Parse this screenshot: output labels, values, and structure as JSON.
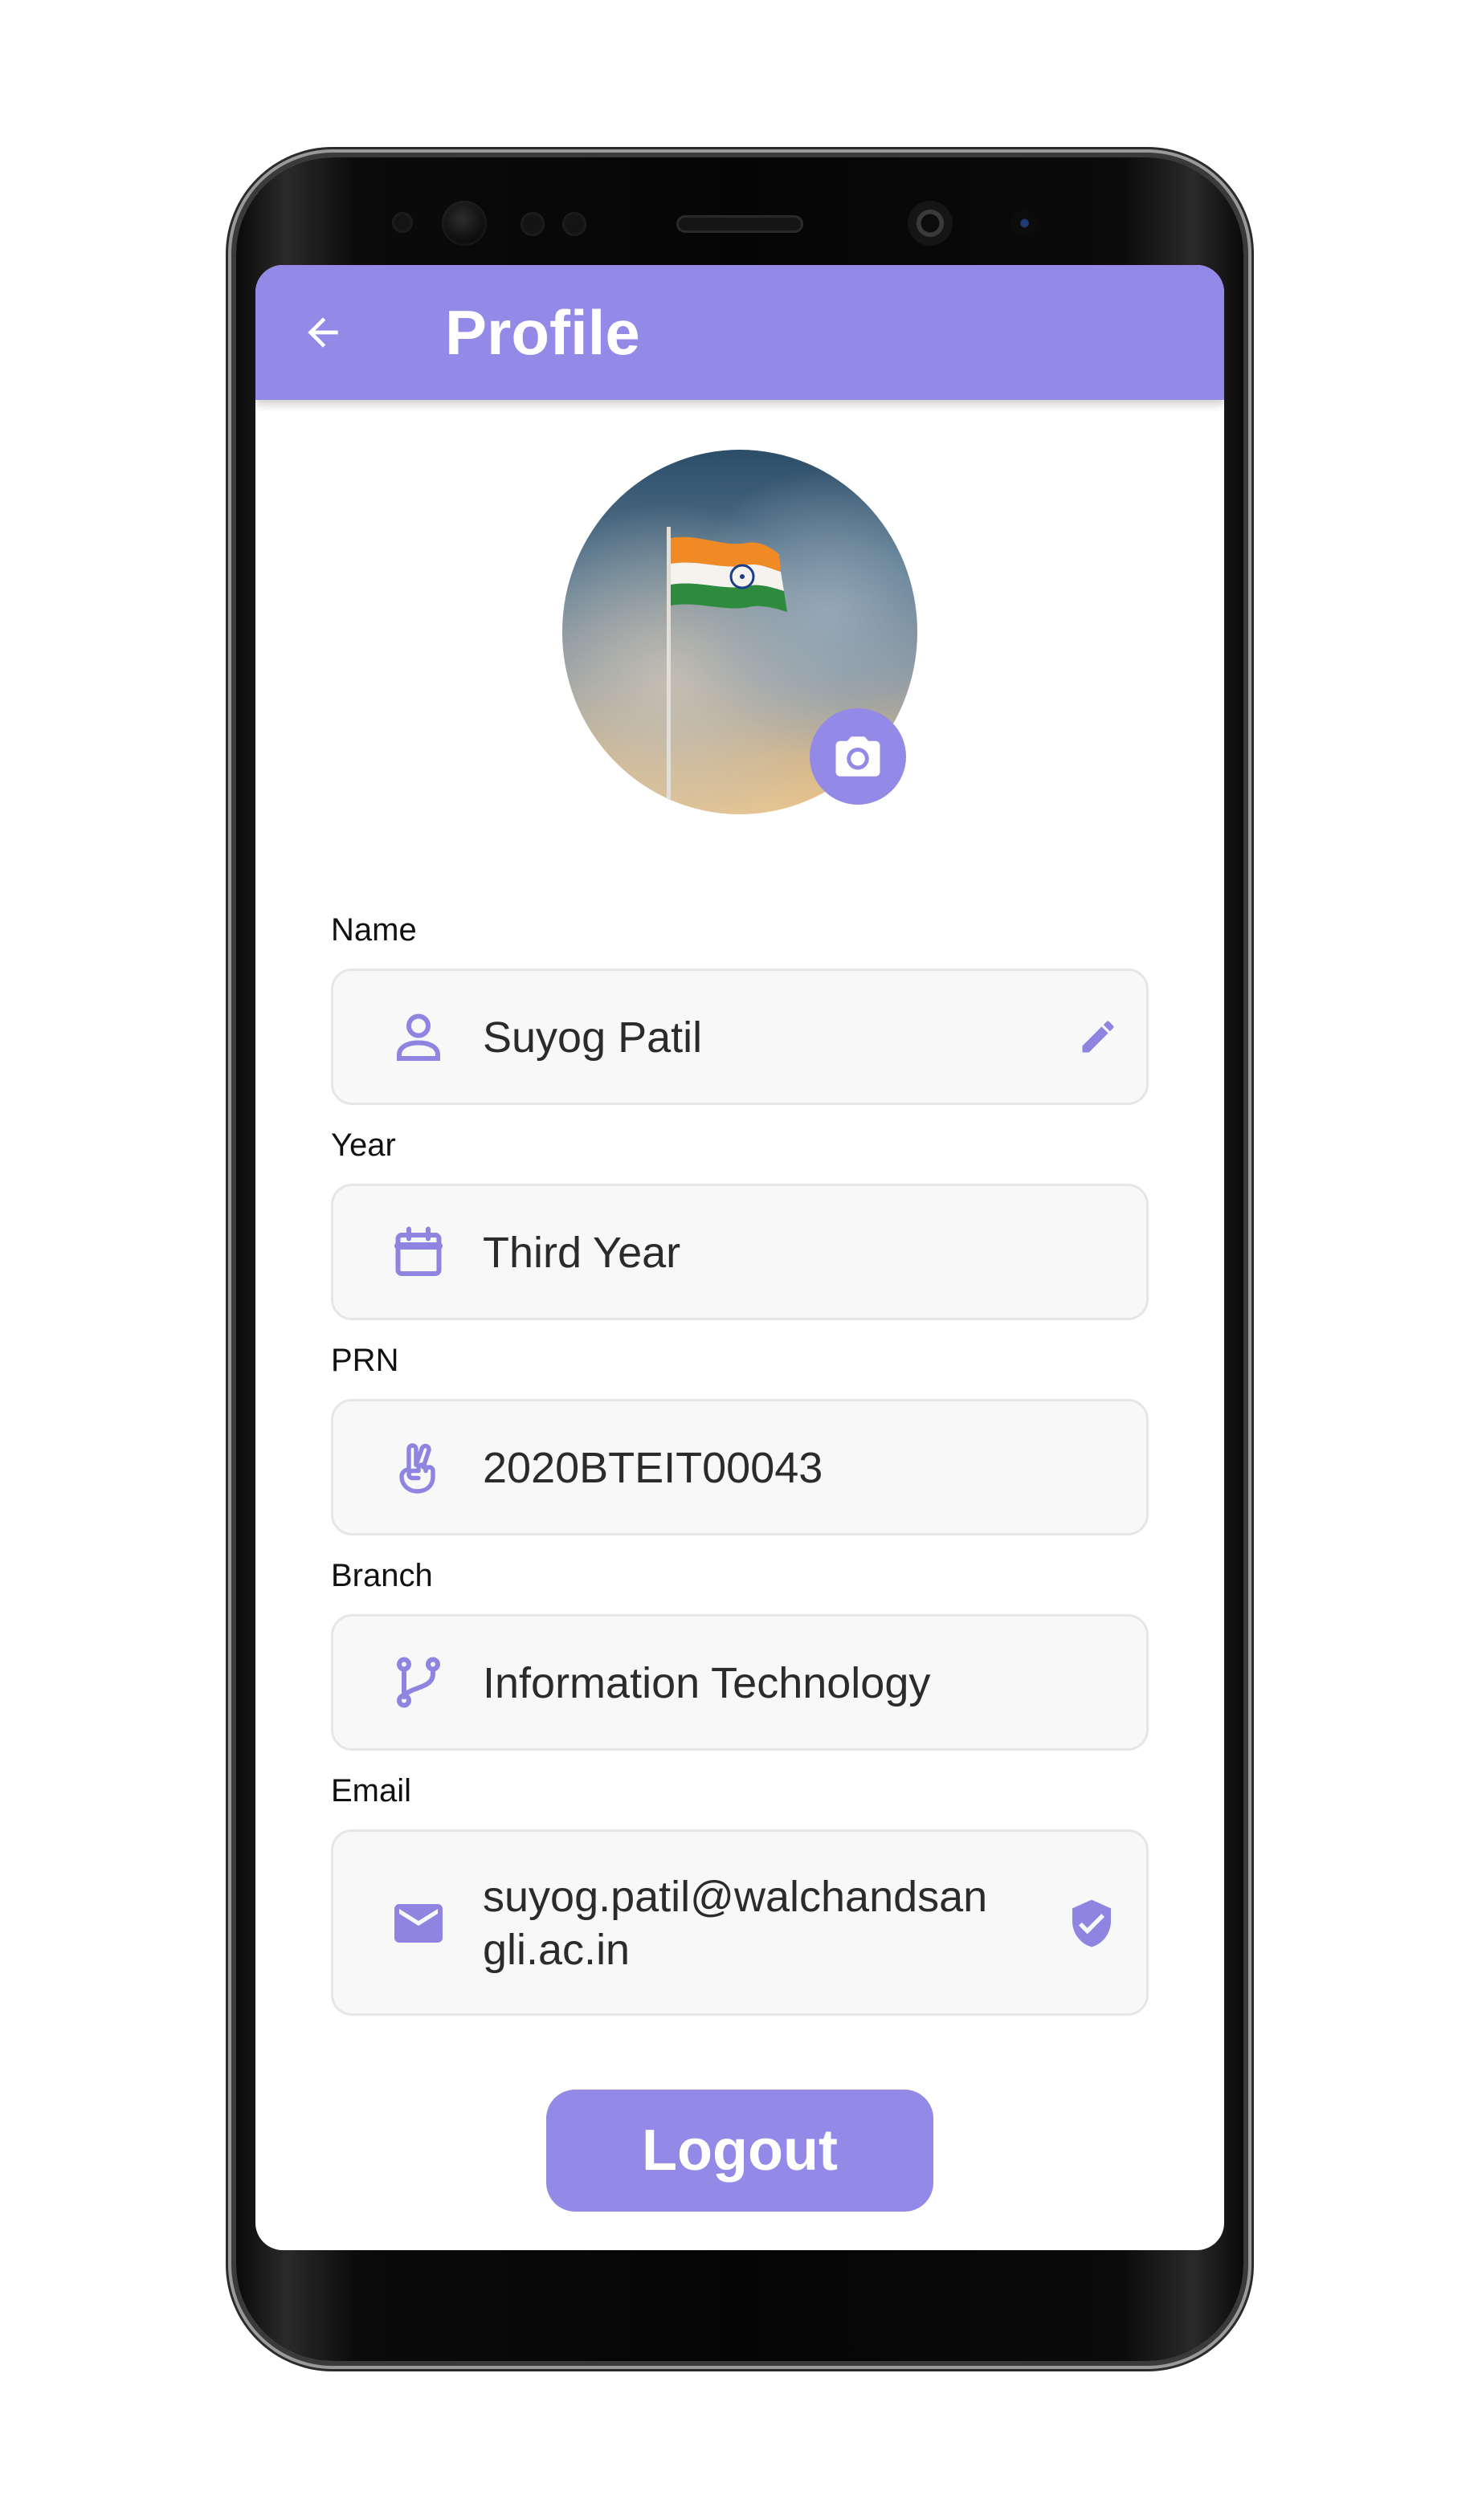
{
  "app": {
    "title": "Profile",
    "accent_color": "#9389e6"
  },
  "avatar": {
    "description_icon": "flag-photo",
    "camera_icon": "camera-icon"
  },
  "fields": {
    "name": {
      "label": "Name",
      "value": "Suyog Patil",
      "icon": "person-icon",
      "trailing_icon": "edit-pencil-icon"
    },
    "year": {
      "label": "Year",
      "value": "Third Year",
      "icon": "calendar-icon"
    },
    "prn": {
      "label": "PRN",
      "value": "2020BTEIT00043",
      "icon": "hand-peace-icon"
    },
    "branch": {
      "label": "Branch",
      "value": "Information Technology",
      "icon": "git-branch-icon"
    },
    "email": {
      "label": "Email",
      "value_line1": "suyog.patil@walchandsan",
      "value_line2": "gli.ac.in",
      "icon": "mail-icon",
      "trailing_icon": "verified-shield-icon"
    }
  },
  "actions": {
    "logout_label": "Logout"
  }
}
